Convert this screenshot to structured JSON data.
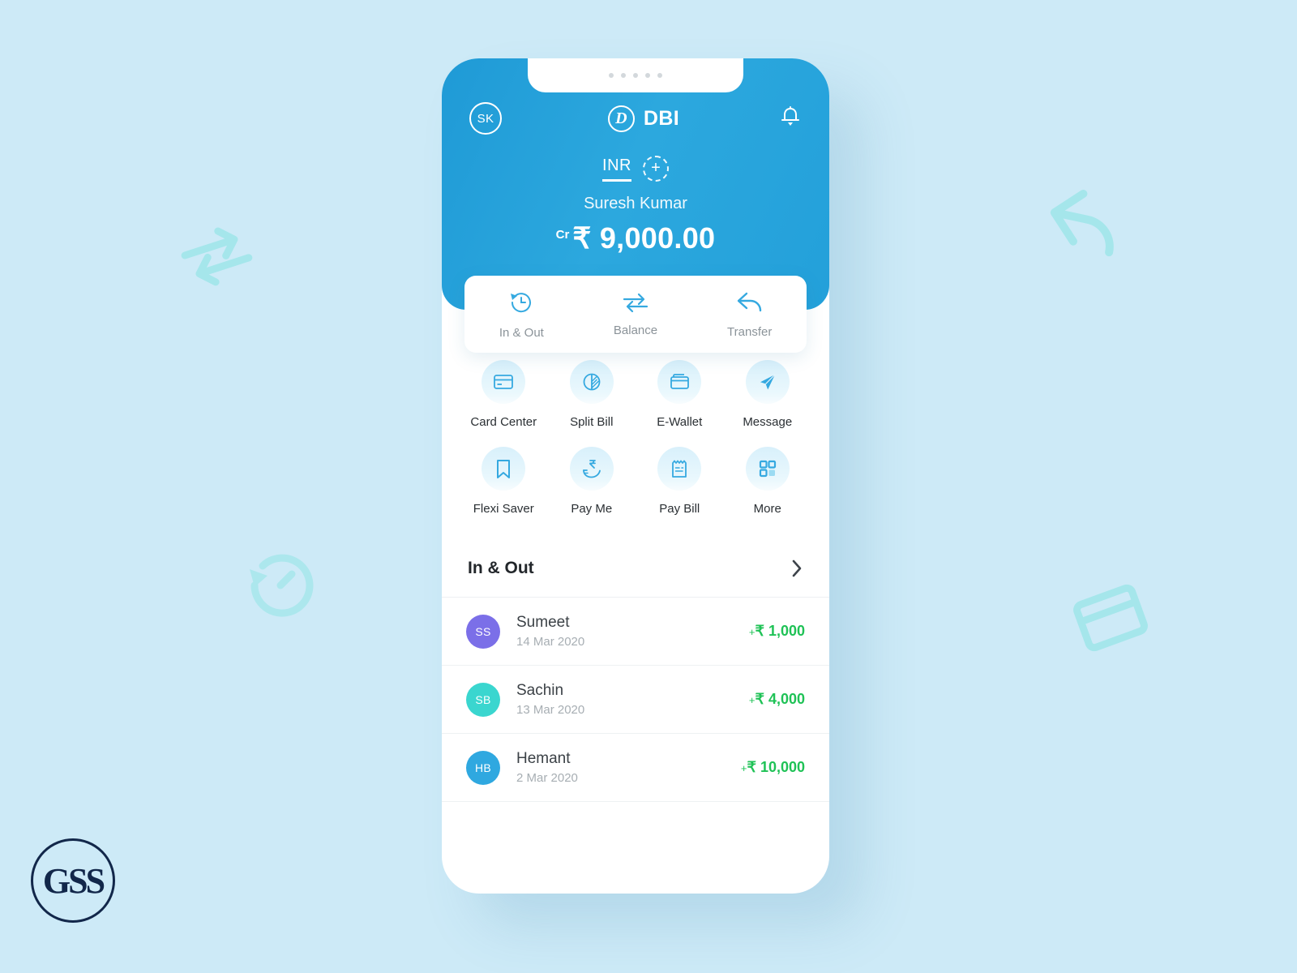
{
  "background": {
    "color": "#cdeaf7"
  },
  "watermark": {
    "text": "GSS"
  },
  "decorations": [
    {
      "name": "exchange-arrows-decoration",
      "icon": "exchange-icon"
    },
    {
      "name": "history-clock-decoration",
      "icon": "history-icon"
    },
    {
      "name": "transfer-arrow-decoration",
      "icon": "reply-arrow-icon"
    },
    {
      "name": "wallet-decoration",
      "icon": "wallet-icon"
    }
  ],
  "phone": {
    "speaker_dots": 5
  },
  "header": {
    "avatar_initials": "SK",
    "brand_mark_letter": "D",
    "brand_name": "DBI",
    "notification_icon": "bell-icon",
    "currency_code": "INR",
    "add_currency_label": "+",
    "account_holder": "Suresh Kumar",
    "balance_prefix": "Cr",
    "balance_amount": "₹ 9,000.00",
    "accent_color": "#23a0da"
  },
  "action_tabs": [
    {
      "label": "In & Out",
      "icon": "history-clock-icon"
    },
    {
      "label": "Balance",
      "icon": "exchange-arrows-icon"
    },
    {
      "label": "Transfer",
      "icon": "reply-arrow-icon"
    }
  ],
  "quick_actions": [
    {
      "label": "Card Center",
      "icon": "credit-card-icon"
    },
    {
      "label": "Split Bill",
      "icon": "pie-split-icon"
    },
    {
      "label": "E-Wallet",
      "icon": "wallet-icon"
    },
    {
      "label": "Message",
      "icon": "paper-plane-icon"
    },
    {
      "label": "Flexi Saver",
      "icon": "bookmark-icon"
    },
    {
      "label": "Pay Me",
      "icon": "hand-rupee-icon"
    },
    {
      "label": "Pay Bill",
      "icon": "receipt-icon"
    },
    {
      "label": "More",
      "icon": "grid-squares-icon"
    }
  ],
  "in_and_out": {
    "title": "In & Out",
    "chevron_icon": "chevron-right-icon",
    "transactions": [
      {
        "initials": "SS",
        "avatar_color": "#7b6fe8",
        "name": "Sumeet",
        "date": "14 Mar 2020",
        "sign": "+",
        "amount": "₹ 1,000"
      },
      {
        "initials": "SB",
        "avatar_color": "#3ad6cf",
        "name": "Sachin",
        "date": "13 Mar 2020",
        "sign": "+",
        "amount": "₹ 4,000"
      },
      {
        "initials": "HB",
        "avatar_color": "#2fa8e0",
        "name": "Hemant",
        "date": "2 Mar 2020",
        "sign": "+",
        "amount": "₹ 10,000"
      }
    ],
    "positive_color": "#1fc256"
  }
}
